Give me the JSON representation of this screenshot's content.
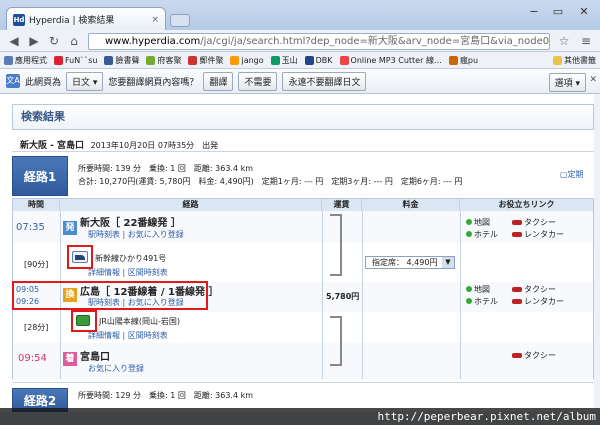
{
  "browser": {
    "tab_title": "Hyperdia | 検索結果",
    "favicon_text": "Hd",
    "tab_close": "×",
    "window_controls": [
      "−",
      "▭",
      "✕"
    ],
    "url_domain": "www.hyperdia.com",
    "url_rest": "/ja/cgi/ja/search.html?dep_node=新大阪&arv_node=宮島口&via_node01=&",
    "bookmarks": [
      "應用程式",
      "FuN``su",
      "臉書聲",
      "府客聚",
      "郵件聚",
      "jango",
      "玉山",
      "DBK",
      "Online MP3 Cutter 線…",
      "瘋pu",
      "其他書籤"
    ]
  },
  "translate_bar": {
    "prefix": "此網頁為",
    "language": "日文",
    "question": "您要翻譯網頁內容嗎？",
    "translate": "翻譯",
    "no": "不需要",
    "never": "永遠不要翻譯日文",
    "options": "選項"
  },
  "page": {
    "header": "検索結果",
    "route_title": "新大阪 - 宮島口",
    "route_meta": "2013年10月20日 07時35分　出発"
  },
  "route1": {
    "badge": "経路1",
    "line1": "所要時間: 139 分　乗換: 1 回　距離: 363.4 km",
    "line2": "合計: 10,270円(運賃: 5,780円　料金: 4,490円)　定期1ヶ月: --- 円　定期3ヶ月: --- 円　定期6ヶ月: --- 円",
    "detail_link": "▢定期"
  },
  "table": {
    "headers": [
      "時間",
      "経路",
      "運賃",
      "料金",
      "お役立ちリンク"
    ],
    "rows": {
      "dep": {
        "time": "07:35",
        "icon": "発",
        "station": "新大阪［ 22番線発 ］",
        "links": "駅時刻表 | お気に入り登録",
        "map": "地図",
        "taxi": "タクシー",
        "hotel": "ホテル",
        "rental": "レンタカー"
      },
      "train1": {
        "minutes": "[90分]",
        "name": "新幹線ひかり491号",
        "links": "詳細情報 | 区間時刻表",
        "seat": "指定席： 4,490円",
        "seat_arrow": "▼"
      },
      "transfer": {
        "time_arr": "09:05",
        "time_dep": "09:26",
        "icon": "換",
        "station": "広島［ 12番線着 / 1番線発 ］",
        "links": "駅時刻表 | お気に入り登録",
        "fare": "5,780円",
        "map": "地図",
        "taxi": "タクシー",
        "hotel": "ホテル",
        "rental": "レンタカー"
      },
      "train2": {
        "minutes": "[28分]",
        "name": "JR山陽本線(岡山-岩国)",
        "links": "詳細情報 | 区間時刻表"
      },
      "arr": {
        "time": "09:54",
        "icon": "着",
        "station": "宮島口",
        "links": "お気に入り登録",
        "taxi": "タクシー"
      }
    }
  },
  "route2": {
    "badge": "経路2",
    "line1": "所要時間: 129 分　乗換: 1 回　距離: 363.4 km"
  },
  "watermark": "http://peperbear.pixnet.net/album"
}
